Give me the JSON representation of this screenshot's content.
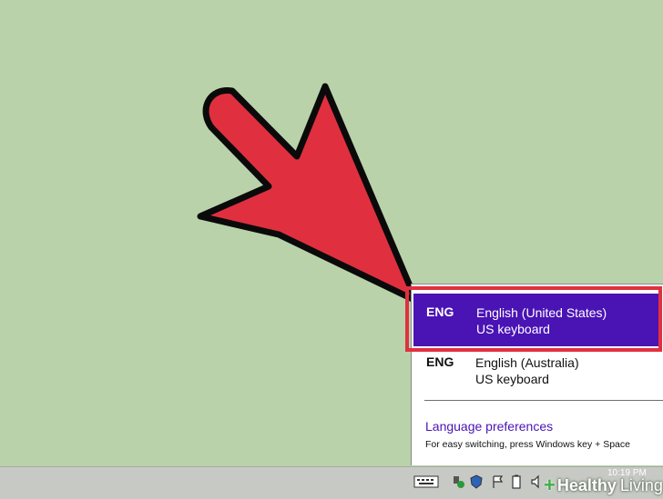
{
  "languages": [
    {
      "code": "ENG",
      "name": "English (United States)",
      "keyboard": "US keyboard",
      "selected": true
    },
    {
      "code": "ENG",
      "name": "English (Australia)",
      "keyboard": "US keyboard",
      "selected": false
    }
  ],
  "footer": {
    "preferences_link": "Language preferences",
    "hint": "For easy switching, press Windows key + Space"
  },
  "taskbar": {
    "clock_time": "10:19 PM",
    "icons": [
      "keyboard-icon",
      "network-icon",
      "shield-icon",
      "flag-icon",
      "battery-icon",
      "volume-icon"
    ]
  },
  "watermark": {
    "plus": "+",
    "word1": "Healthy",
    "word2": "Living"
  },
  "colors": {
    "background": "#b9d2aa",
    "selected": "#4a13b4",
    "highlight": "#e0303f",
    "arrow": "#e0303f"
  }
}
